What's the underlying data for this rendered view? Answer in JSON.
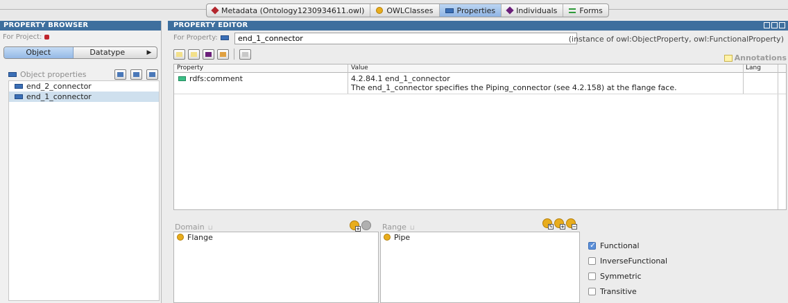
{
  "tabs": [
    {
      "label": "Metadata (Ontology1230934611.owl)",
      "icon": "diamond-red-icon"
    },
    {
      "label": "OWLClasses",
      "icon": "class-circle-icon"
    },
    {
      "label": "Properties",
      "icon": "property-icon",
      "active": true
    },
    {
      "label": "Individuals",
      "icon": "diamond-purple-icon"
    },
    {
      "label": "Forms",
      "icon": "forms-icon"
    }
  ],
  "left": {
    "header": "PROPERTY BROWSER",
    "for_project_label": "For Project:",
    "segments": [
      "Object",
      "Datatype"
    ],
    "section_label": "Object properties",
    "tree": [
      "end_2_connector",
      "end_1_connector"
    ],
    "selected": "end_1_connector"
  },
  "editor": {
    "header": "PROPERTY EDITOR",
    "for_property_label": "For Property:",
    "property_name": "end_1_connector",
    "instance_note": "(instance of owl:ObjectProperty, owl:FunctionalProperty)",
    "annotations_label": "Annotations",
    "table": {
      "columns": [
        "Property",
        "Value",
        "Lang"
      ],
      "rows": [
        {
          "property": "rdfs:comment",
          "value_line1": "4.2.84.1  end_1_connector",
          "value_line2": "The end_1_connector specifies the Piping_connector (see 4.2.158) at the flange face.",
          "lang": ""
        }
      ]
    },
    "domain": {
      "label": "Domain",
      "mark": "⊔",
      "items": [
        "Flange"
      ]
    },
    "range": {
      "label": "Range",
      "mark": "⊔",
      "items": [
        "Pipe"
      ]
    },
    "characteristics": [
      {
        "label": "Functional",
        "checked": true
      },
      {
        "label": "InverseFunctional",
        "checked": false
      },
      {
        "label": "Symmetric",
        "checked": false
      },
      {
        "label": "Transitive",
        "checked": false
      }
    ]
  }
}
